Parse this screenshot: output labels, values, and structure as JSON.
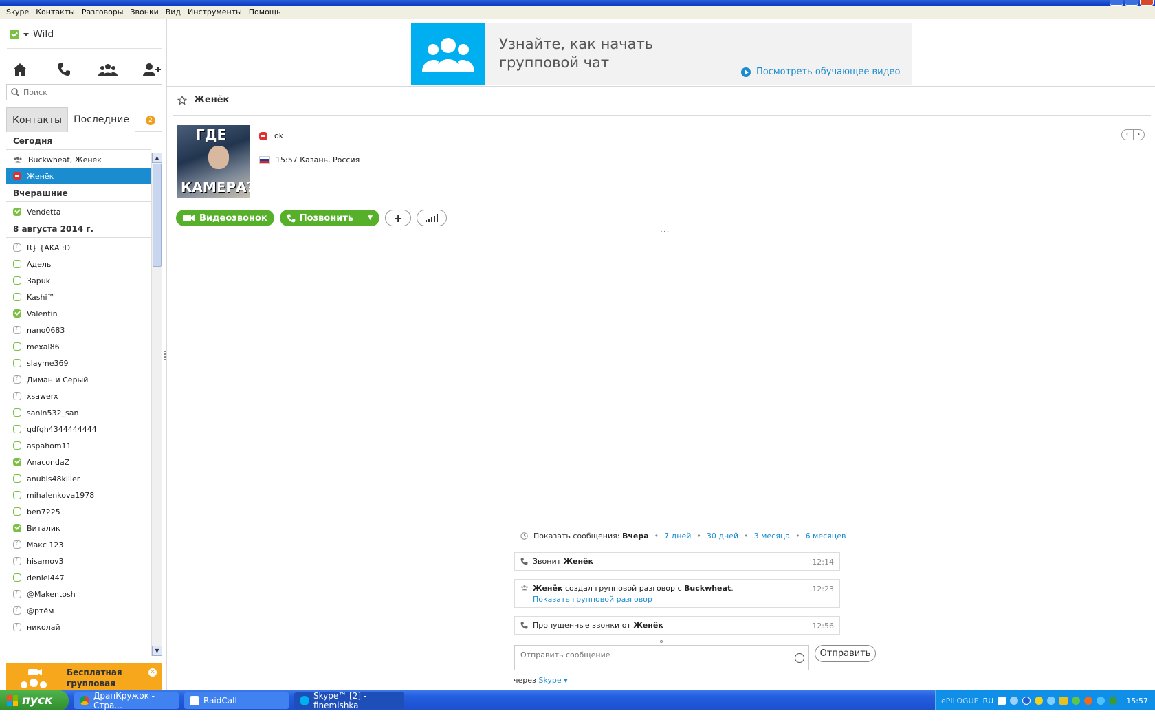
{
  "menu": [
    "Skype",
    "Контакты",
    "Разговоры",
    "Звонки",
    "Вид",
    "Инструменты",
    "Помощь"
  ],
  "user": {
    "name": "Wild"
  },
  "search": {
    "placeholder": "Поиск"
  },
  "tabs": {
    "contacts": "Контакты",
    "recent": "Последние",
    "badge": "2"
  },
  "groups": {
    "today": "Сегодня",
    "yesterday": "Вчерашние",
    "aug8": "8 августа 2014 г."
  },
  "today_rows": [
    {
      "name": "Buckwheat, Женёк",
      "status": "group"
    },
    {
      "name": "Женёк",
      "status": "busy",
      "selected": true
    }
  ],
  "yesterday_rows": [
    {
      "name": "Vendetta",
      "status": "online"
    }
  ],
  "aug_rows": [
    {
      "name": "R}|{AKA :D",
      "status": "unknown"
    },
    {
      "name": "Адель",
      "status": "offline"
    },
    {
      "name": "3apuk",
      "status": "offline"
    },
    {
      "name": "Kashi™",
      "status": "offline"
    },
    {
      "name": "Valentin",
      "status": "online"
    },
    {
      "name": "nano0683",
      "status": "unknown"
    },
    {
      "name": "mexal86",
      "status": "offline"
    },
    {
      "name": "slayme369",
      "status": "offline"
    },
    {
      "name": "Диман и Серый",
      "status": "unknown"
    },
    {
      "name": "xsawerx",
      "status": "unknown"
    },
    {
      "name": "sanin532_san",
      "status": "offline"
    },
    {
      "name": "gdfgh4344444444",
      "status": "offline"
    },
    {
      "name": "aspahom11",
      "status": "offline"
    },
    {
      "name": "AnacondaZ",
      "status": "online"
    },
    {
      "name": "anubis48killer",
      "status": "offline"
    },
    {
      "name": "mihalenkova1978",
      "status": "offline"
    },
    {
      "name": "ben7225",
      "status": "offline"
    },
    {
      "name": "Виталик",
      "status": "online"
    },
    {
      "name": "Макс 123",
      "status": "unknown"
    },
    {
      "name": "hisamov3",
      "status": "unknown"
    },
    {
      "name": "deniel447",
      "status": "offline"
    },
    {
      "name": "@Makentosh",
      "status": "unknown"
    },
    {
      "name": "@ртём",
      "status": "unknown"
    },
    {
      "name": "николай",
      "status": "unknown"
    }
  ],
  "promo": {
    "text": "Бесплатная групповая видеосвязь"
  },
  "banner": {
    "title": "Узнайте, как начать групповой чат",
    "link": "Посмотреть обучающее видео"
  },
  "conversation": {
    "name": "Женёк",
    "mood": "ok",
    "local_time": "15:57 Казань, Россия",
    "video_call": "Видеозвонок",
    "call": "Позвонить"
  },
  "history": {
    "label": "Показать сообщения:",
    "current": "Вчера",
    "options": [
      "7 дней",
      "30 дней",
      "3 месяца",
      "6 месяцев"
    ]
  },
  "events": [
    {
      "text_prefix": "Звонит ",
      "bold": "Женёк",
      "time": "12:14"
    },
    {
      "bold1": "Женёк",
      "mid": " создал групповой разговор с ",
      "bold2": "Buckwheat",
      "end": ".",
      "link": "Показать групповой разговор",
      "time": "12:23"
    },
    {
      "text_prefix": "Пропущенные звонки от ",
      "bold": "Женёк",
      "time": "12:56"
    }
  ],
  "composer": {
    "placeholder": "Отправить сообщение",
    "send": "Отправить",
    "via": "через",
    "via_service": "Skype"
  },
  "taskbar": {
    "start": "пуск",
    "tasks": [
      "ДрапКружок - Стра...",
      "RaidCall",
      "Skype™ [2] - finemishka"
    ],
    "tray_text": "ePILOGUE",
    "lang": "RU",
    "clock": "15:57"
  }
}
